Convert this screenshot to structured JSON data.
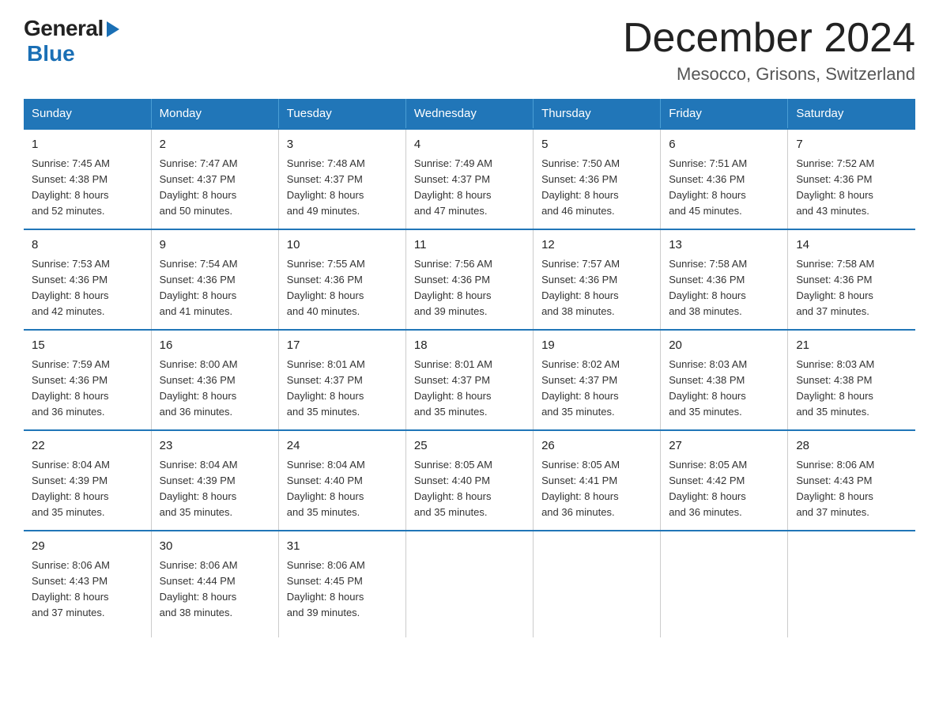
{
  "logo": {
    "general": "General",
    "blue": "Blue",
    "tagline": "Blue"
  },
  "header": {
    "title": "December 2024",
    "subtitle": "Mesocco, Grisons, Switzerland"
  },
  "days_of_week": [
    "Sunday",
    "Monday",
    "Tuesday",
    "Wednesday",
    "Thursday",
    "Friday",
    "Saturday"
  ],
  "weeks": [
    [
      {
        "day": "1",
        "info": "Sunrise: 7:45 AM\nSunset: 4:38 PM\nDaylight: 8 hours\nand 52 minutes."
      },
      {
        "day": "2",
        "info": "Sunrise: 7:47 AM\nSunset: 4:37 PM\nDaylight: 8 hours\nand 50 minutes."
      },
      {
        "day": "3",
        "info": "Sunrise: 7:48 AM\nSunset: 4:37 PM\nDaylight: 8 hours\nand 49 minutes."
      },
      {
        "day": "4",
        "info": "Sunrise: 7:49 AM\nSunset: 4:37 PM\nDaylight: 8 hours\nand 47 minutes."
      },
      {
        "day": "5",
        "info": "Sunrise: 7:50 AM\nSunset: 4:36 PM\nDaylight: 8 hours\nand 46 minutes."
      },
      {
        "day": "6",
        "info": "Sunrise: 7:51 AM\nSunset: 4:36 PM\nDaylight: 8 hours\nand 45 minutes."
      },
      {
        "day": "7",
        "info": "Sunrise: 7:52 AM\nSunset: 4:36 PM\nDaylight: 8 hours\nand 43 minutes."
      }
    ],
    [
      {
        "day": "8",
        "info": "Sunrise: 7:53 AM\nSunset: 4:36 PM\nDaylight: 8 hours\nand 42 minutes."
      },
      {
        "day": "9",
        "info": "Sunrise: 7:54 AM\nSunset: 4:36 PM\nDaylight: 8 hours\nand 41 minutes."
      },
      {
        "day": "10",
        "info": "Sunrise: 7:55 AM\nSunset: 4:36 PM\nDaylight: 8 hours\nand 40 minutes."
      },
      {
        "day": "11",
        "info": "Sunrise: 7:56 AM\nSunset: 4:36 PM\nDaylight: 8 hours\nand 39 minutes."
      },
      {
        "day": "12",
        "info": "Sunrise: 7:57 AM\nSunset: 4:36 PM\nDaylight: 8 hours\nand 38 minutes."
      },
      {
        "day": "13",
        "info": "Sunrise: 7:58 AM\nSunset: 4:36 PM\nDaylight: 8 hours\nand 38 minutes."
      },
      {
        "day": "14",
        "info": "Sunrise: 7:58 AM\nSunset: 4:36 PM\nDaylight: 8 hours\nand 37 minutes."
      }
    ],
    [
      {
        "day": "15",
        "info": "Sunrise: 7:59 AM\nSunset: 4:36 PM\nDaylight: 8 hours\nand 36 minutes."
      },
      {
        "day": "16",
        "info": "Sunrise: 8:00 AM\nSunset: 4:36 PM\nDaylight: 8 hours\nand 36 minutes."
      },
      {
        "day": "17",
        "info": "Sunrise: 8:01 AM\nSunset: 4:37 PM\nDaylight: 8 hours\nand 35 minutes."
      },
      {
        "day": "18",
        "info": "Sunrise: 8:01 AM\nSunset: 4:37 PM\nDaylight: 8 hours\nand 35 minutes."
      },
      {
        "day": "19",
        "info": "Sunrise: 8:02 AM\nSunset: 4:37 PM\nDaylight: 8 hours\nand 35 minutes."
      },
      {
        "day": "20",
        "info": "Sunrise: 8:03 AM\nSunset: 4:38 PM\nDaylight: 8 hours\nand 35 minutes."
      },
      {
        "day": "21",
        "info": "Sunrise: 8:03 AM\nSunset: 4:38 PM\nDaylight: 8 hours\nand 35 minutes."
      }
    ],
    [
      {
        "day": "22",
        "info": "Sunrise: 8:04 AM\nSunset: 4:39 PM\nDaylight: 8 hours\nand 35 minutes."
      },
      {
        "day": "23",
        "info": "Sunrise: 8:04 AM\nSunset: 4:39 PM\nDaylight: 8 hours\nand 35 minutes."
      },
      {
        "day": "24",
        "info": "Sunrise: 8:04 AM\nSunset: 4:40 PM\nDaylight: 8 hours\nand 35 minutes."
      },
      {
        "day": "25",
        "info": "Sunrise: 8:05 AM\nSunset: 4:40 PM\nDaylight: 8 hours\nand 35 minutes."
      },
      {
        "day": "26",
        "info": "Sunrise: 8:05 AM\nSunset: 4:41 PM\nDaylight: 8 hours\nand 36 minutes."
      },
      {
        "day": "27",
        "info": "Sunrise: 8:05 AM\nSunset: 4:42 PM\nDaylight: 8 hours\nand 36 minutes."
      },
      {
        "day": "28",
        "info": "Sunrise: 8:06 AM\nSunset: 4:43 PM\nDaylight: 8 hours\nand 37 minutes."
      }
    ],
    [
      {
        "day": "29",
        "info": "Sunrise: 8:06 AM\nSunset: 4:43 PM\nDaylight: 8 hours\nand 37 minutes."
      },
      {
        "day": "30",
        "info": "Sunrise: 8:06 AM\nSunset: 4:44 PM\nDaylight: 8 hours\nand 38 minutes."
      },
      {
        "day": "31",
        "info": "Sunrise: 8:06 AM\nSunset: 4:45 PM\nDaylight: 8 hours\nand 39 minutes."
      },
      {
        "day": "",
        "info": ""
      },
      {
        "day": "",
        "info": ""
      },
      {
        "day": "",
        "info": ""
      },
      {
        "day": "",
        "info": ""
      }
    ]
  ]
}
